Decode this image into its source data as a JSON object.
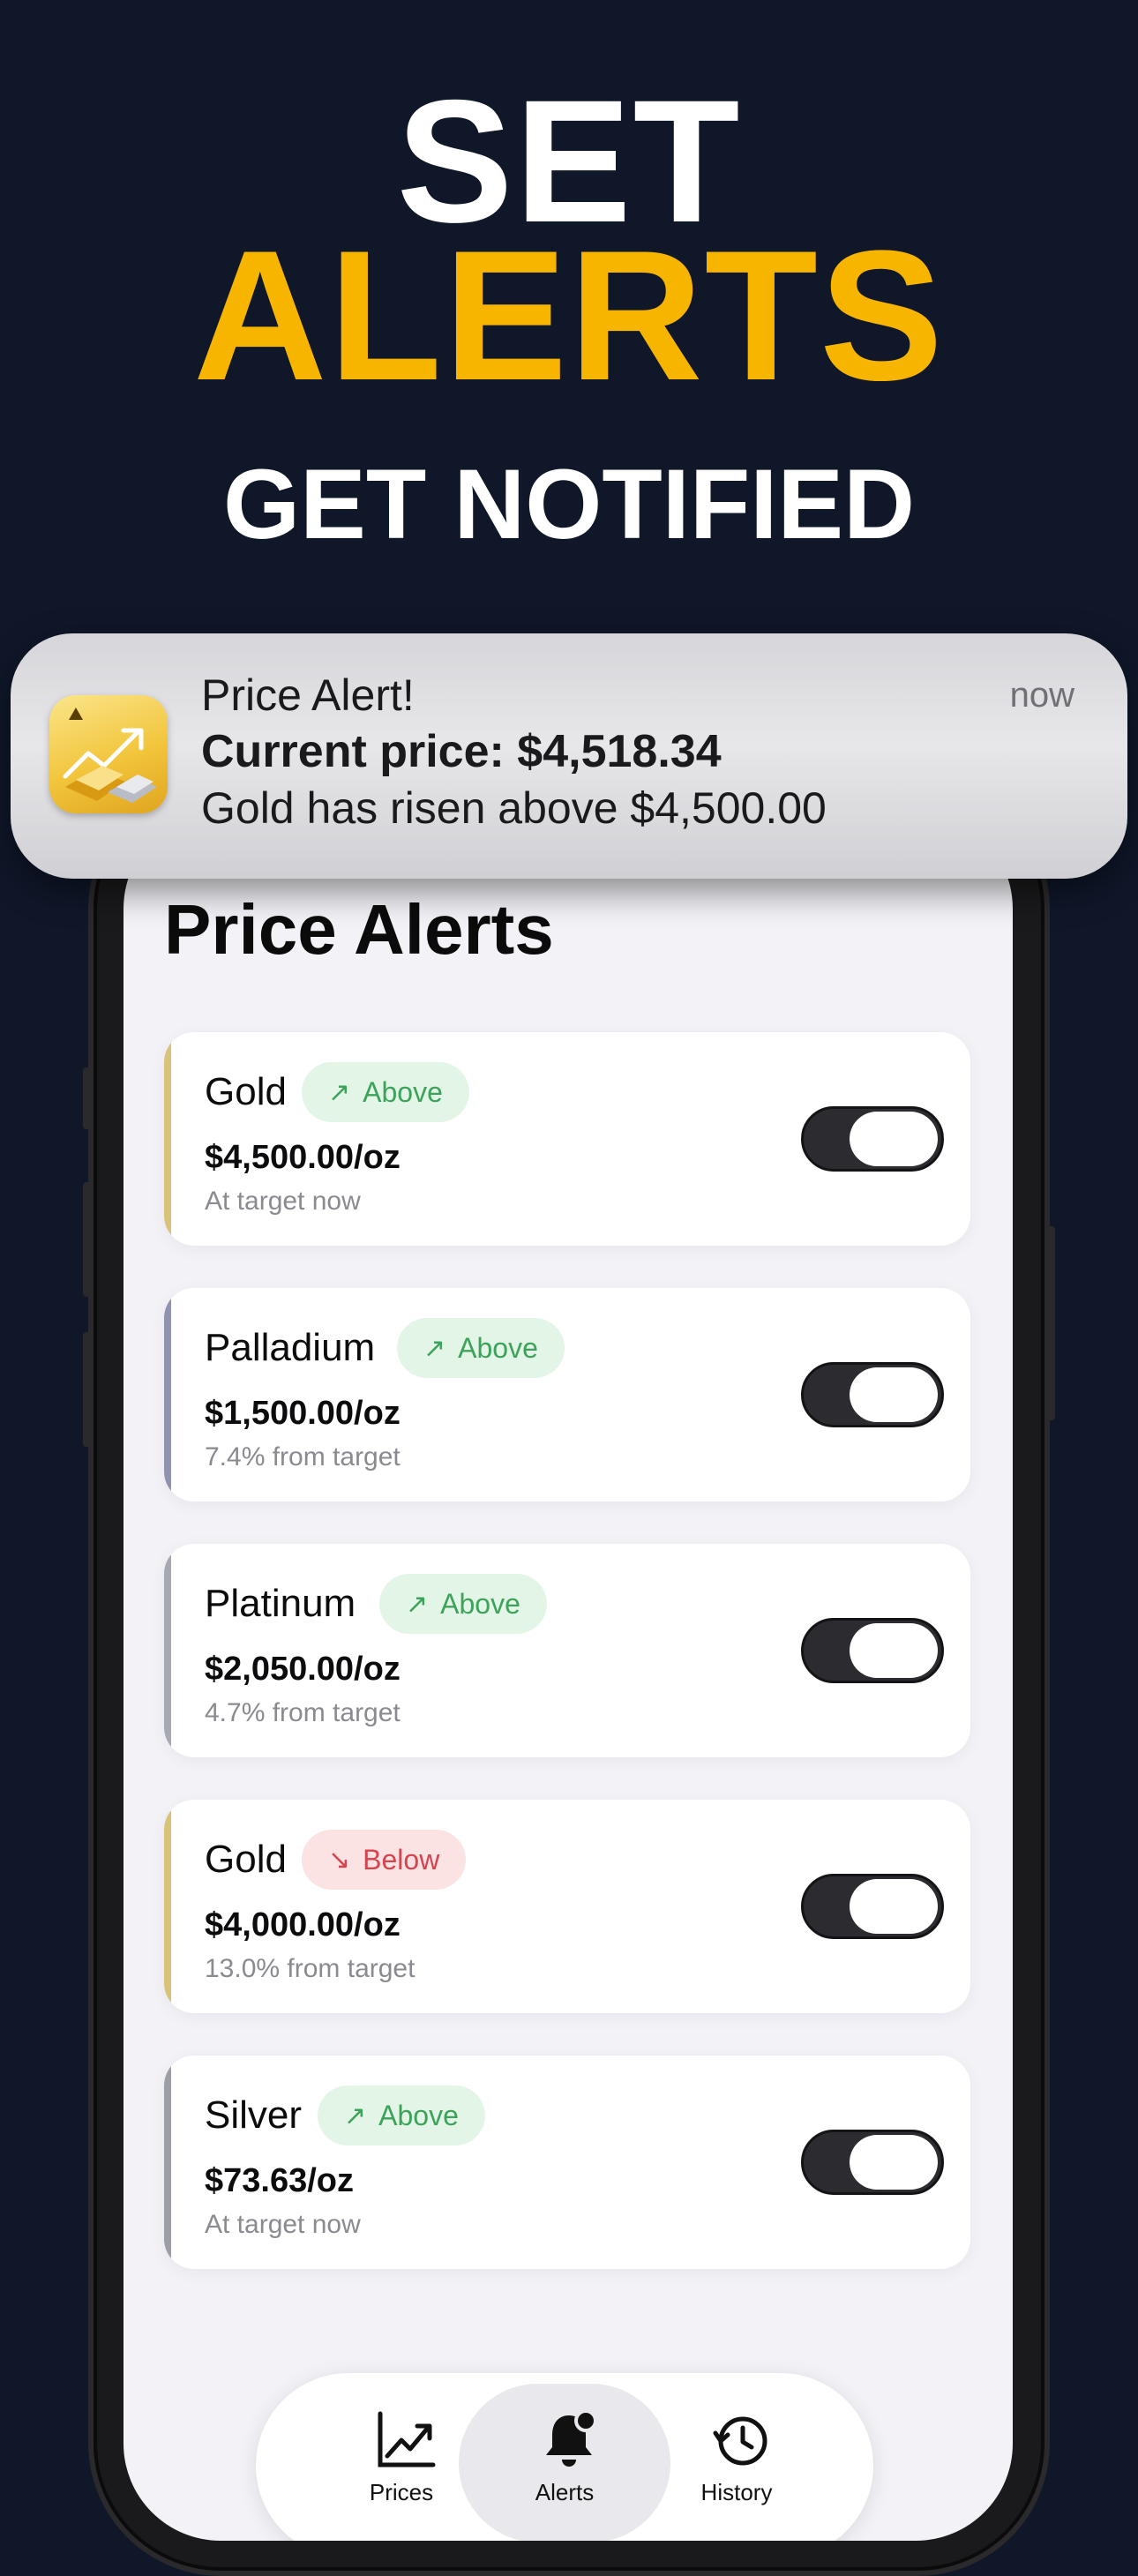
{
  "hero": {
    "line1": "SET",
    "line2": "ALERTS",
    "subtitle": "GET NOTIFIED"
  },
  "notification": {
    "app_icon": "gold-bars-chart-icon",
    "title": "Price Alert!",
    "line1": "Current price: $4,518.34",
    "line2": "Gold has risen above $4,500.00",
    "time": "now"
  },
  "screen": {
    "title": "Price Alerts",
    "alerts": [
      {
        "metal": "Gold",
        "direction": "Above",
        "price": "$4,500.00/oz",
        "status": "At target now",
        "accent": "#d9c27a",
        "enabled": true
      },
      {
        "metal": "Palladium",
        "direction": "Above",
        "price": "$1,500.00/oz",
        "status": "7.4% from target",
        "accent": "#8f93b0",
        "enabled": true
      },
      {
        "metal": "Platinum",
        "direction": "Above",
        "price": "$2,050.00/oz",
        "status": "4.7% from target",
        "accent": "#a6a8b2",
        "enabled": true
      },
      {
        "metal": "Gold",
        "direction": "Below",
        "price": "$4,000.00/oz",
        "status": "13.0% from target",
        "accent": "#d9c27a",
        "enabled": true
      },
      {
        "metal": "Silver",
        "direction": "Above",
        "price": "$73.63/oz",
        "status": "At target now",
        "accent": "#9d9fa6",
        "enabled": true
      }
    ]
  },
  "tabbar": {
    "tabs": [
      {
        "icon": "chart-line-icon",
        "label": "Prices"
      },
      {
        "icon": "bell-badge-icon",
        "label": "Alerts"
      },
      {
        "icon": "history-icon",
        "label": "History"
      }
    ],
    "active": "Alerts"
  },
  "colors": {
    "background": "#0f1729",
    "accent_yellow": "#f7b500",
    "above_green": "#3da35a",
    "below_red": "#d4454f"
  }
}
